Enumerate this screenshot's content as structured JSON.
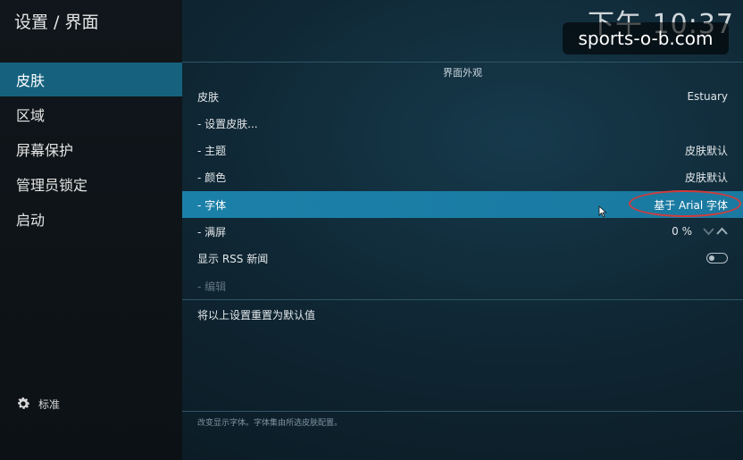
{
  "header": {
    "breadcrumb": "设置 / 界面",
    "clock": "下午 10:37"
  },
  "watermark": "sports-o-b.com",
  "sidebar": {
    "items": [
      {
        "label": "皮肤",
        "active": true
      },
      {
        "label": "区域",
        "active": false
      },
      {
        "label": "屏幕保护",
        "active": false
      },
      {
        "label": "管理员锁定",
        "active": false
      },
      {
        "label": "启动",
        "active": false
      }
    ],
    "level_label": "标准"
  },
  "main": {
    "section_title": "界面外观",
    "rows": [
      {
        "label": "皮肤",
        "value": "Estuary"
      },
      {
        "label": "- 设置皮肤...",
        "value": ""
      },
      {
        "label": "- 主题",
        "value": "皮肤默认"
      },
      {
        "label": "- 颜色",
        "value": "皮肤默认"
      },
      {
        "label": "- 字体",
        "value": "基于 Arial 字体"
      },
      {
        "label": "- 满屏",
        "value": "0 %"
      },
      {
        "label": "显示 RSS 新闻",
        "value": ""
      },
      {
        "label": "- 编辑",
        "value": ""
      }
    ],
    "reset_label": "将以上设置重置为默认值",
    "hint": "改变显示字体。字体集由所选皮肤配置。"
  },
  "colors": {
    "accent": "#16627e",
    "focus": "#1b80a8",
    "highlight_ring": "#d23b3b"
  },
  "icons": [
    "gear-icon",
    "chevron-down-icon",
    "chevron-up-icon",
    "toggle-icon",
    "cursor-icon"
  ]
}
